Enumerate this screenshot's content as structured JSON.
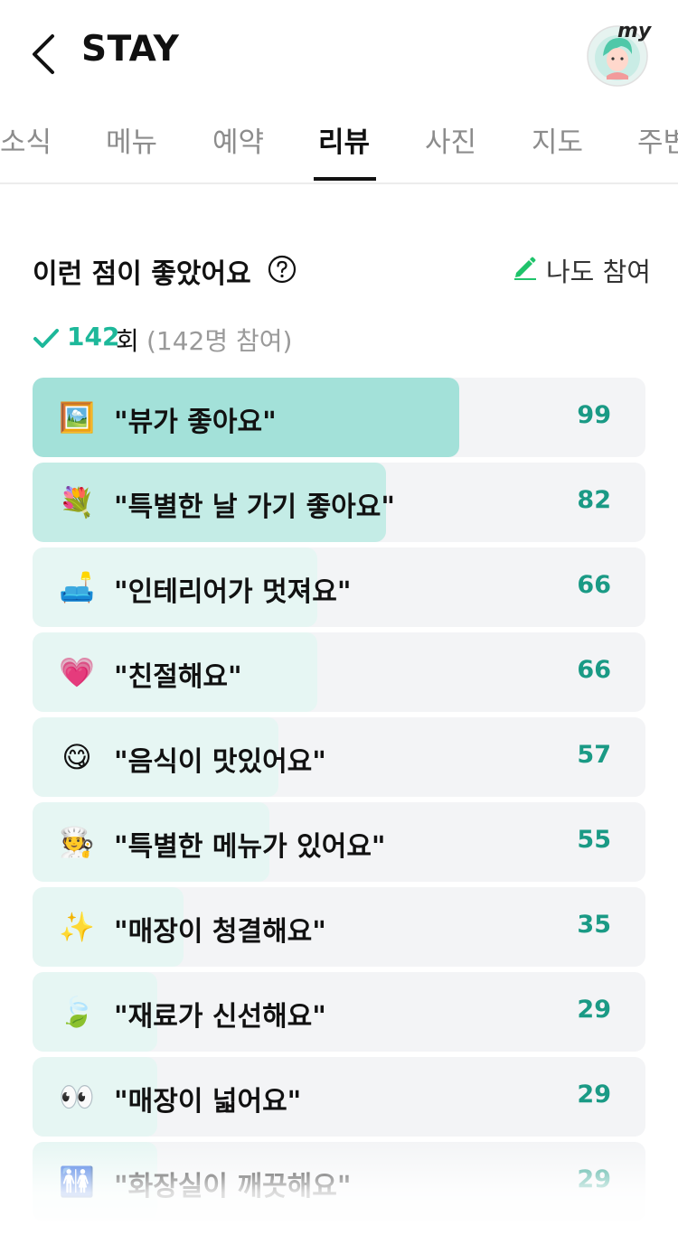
{
  "header": {
    "title": "STAY",
    "my_label": "my"
  },
  "tabs": [
    {
      "label": "소식",
      "active": false
    },
    {
      "label": "메뉴",
      "active": false
    },
    {
      "label": "예약",
      "active": false
    },
    {
      "label": "리뷰",
      "active": true
    },
    {
      "label": "사진",
      "active": false
    },
    {
      "label": "지도",
      "active": false
    },
    {
      "label": "주변",
      "active": false
    }
  ],
  "section": {
    "title": "이런 점이 좋았어요",
    "join_label": "나도 참여",
    "count_value": "142",
    "count_unit": "회",
    "participants": "(142명 참여)"
  },
  "colors": {
    "accent": "#1db89a",
    "fill_strong": "#a3e1d9",
    "fill_light": "#c4ece6",
    "fill_faint": "#e6f6f3"
  },
  "reviews": [
    {
      "icon": "picture-icon",
      "emoji": "🖼️",
      "text": "\"뷰가 좋아요\"",
      "count": "99",
      "fraction": 0.696
    },
    {
      "icon": "bouquet-icon",
      "emoji": "💐",
      "text": "\"특별한 날 가기 좋아요\"",
      "count": "82",
      "fraction": 0.577
    },
    {
      "icon": "sofa-lamp-icon",
      "emoji": "🛋️",
      "text": "\"인테리어가 멋져요\"",
      "count": "66",
      "fraction": 0.465
    },
    {
      "icon": "heart-face-icon",
      "emoji": "💗",
      "text": "\"친절해요\"",
      "count": "66",
      "fraction": 0.465
    },
    {
      "icon": "yum-face-icon",
      "emoji": "😋",
      "text": "\"음식이 맛있어요\"",
      "count": "57",
      "fraction": 0.401
    },
    {
      "icon": "chef-icon",
      "emoji": "🧑‍🍳",
      "text": "\"특별한 메뉴가 있어요\"",
      "count": "55",
      "fraction": 0.387
    },
    {
      "icon": "sparkles-icon",
      "emoji": "✨",
      "text": "\"매장이 청결해요\"",
      "count": "35",
      "fraction": 0.246
    },
    {
      "icon": "leaf-icon",
      "emoji": "🍃",
      "text": "\"재료가 신선해요\"",
      "count": "29",
      "fraction": 0.204
    },
    {
      "icon": "eyes-icon",
      "emoji": "👀",
      "text": "\"매장이 넓어요\"",
      "count": "29",
      "fraction": 0.204
    },
    {
      "icon": "restroom-icon",
      "emoji": "🚻",
      "text": "\"화장실이 깨끗해요\"",
      "count": "29",
      "fraction": 0.204
    }
  ]
}
